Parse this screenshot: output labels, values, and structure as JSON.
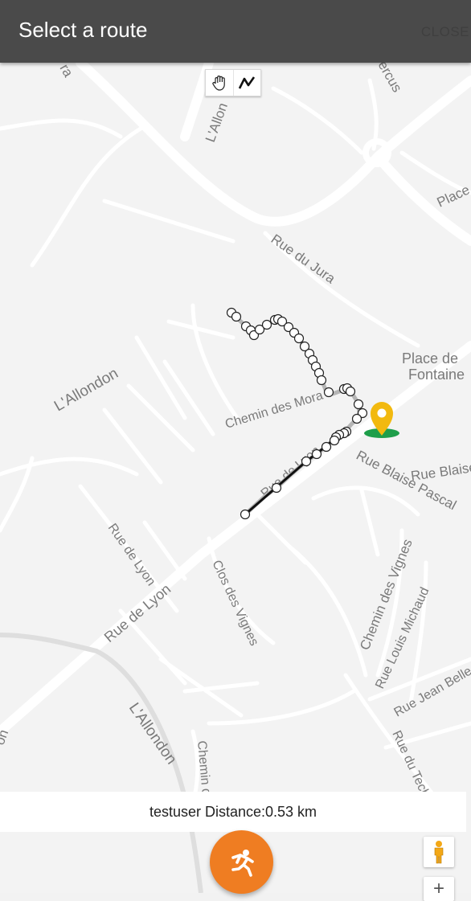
{
  "header": {
    "title": "Select a route",
    "close_label": "CLOSE"
  },
  "toolbox": {
    "pan_icon": "hand-icon",
    "draw_icon": "polyline-icon"
  },
  "map": {
    "labels": {
      "lallon_top": "L'Allon",
      "ra": "ra",
      "ercus": "ercus",
      "place_right": "Place",
      "rue_du_jura": "Rue du Jura",
      "lallondon_mid": "L'Allondon",
      "place_de": "Place de",
      "fontaine": "Fontaine",
      "chemin_des_mora": "Chemin des Mora",
      "rue_blaise_pascal": "Rue Blaise Pascal",
      "rue_de_lyon_small": "Rue de Lyon",
      "rue_de_lyon_main": "Rue de Lyon",
      "rue_de_lyon_route": "Rue de Lyon",
      "clos_des_vignes": "Clos des Vignes",
      "chemin_des_vignes": "Chemin des Vignes",
      "rue_louis_michaud": "Rue Louis Michaud",
      "rue_jean_belle": "Rue Jean Belle",
      "lallondon_bottom": "L'Allondon",
      "chemin_bottom": "Chemin d",
      "rue_du_tech": "Rue du Tech",
      "on": "on"
    }
  },
  "status": {
    "distance_text": "testuser Distance:0.53 km"
  },
  "fab": {
    "icon": "running-person-icon",
    "color": "#ef7d22"
  },
  "controls": {
    "pegman_icon": "pegman-icon",
    "zoom_in_label": "+"
  },
  "colors": {
    "header_bg": "#4a4a4a",
    "marker_yellow": "#f2b90f",
    "marker_green": "#1e9e4a"
  }
}
